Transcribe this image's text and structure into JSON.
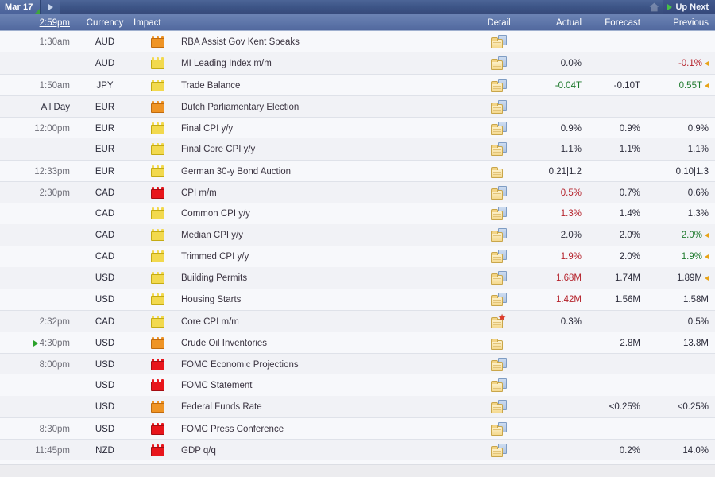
{
  "topbar": {
    "date_label": "Mar 17",
    "next_day_icon": "chevron-right-icon",
    "home_icon": "home-icon",
    "up_next_label": "Up Next",
    "up_next_icon": "play-triangle-icon"
  },
  "columns": {
    "time": "2:59pm",
    "currency": "Currency",
    "impact": "Impact",
    "detail": "Detail",
    "actual": "Actual",
    "forecast": "Forecast",
    "previous": "Previous"
  },
  "colors": {
    "impact_low": "#f2d94e",
    "impact_medium": "#ef9425",
    "impact_high": "#e8151b",
    "value_better": "#1f7a2e",
    "value_worse": "#b5232c",
    "value_neutral": "#2b2b3a",
    "revision_arrow": "#e8a317",
    "next_marker": "#2aa22a",
    "header_blue": "#5d75a9"
  },
  "rows": [
    {
      "time": "1:30am",
      "currency": "AUD",
      "impact": "medium",
      "event": "RBA Assist Gov Kent Speaks",
      "detail_icon": "folder-page-icon",
      "actual": "",
      "actual_tone": "neutral",
      "forecast": "",
      "previous": "",
      "previous_tone": "neutral",
      "revised": false,
      "next": false
    },
    {
      "time": "",
      "currency": "AUD",
      "impact": "low",
      "event": "MI Leading Index m/m",
      "detail_icon": "folder-page-icon",
      "actual": "0.0%",
      "actual_tone": "neutral",
      "forecast": "",
      "previous": "-0.1%",
      "previous_tone": "worse",
      "revised": true,
      "next": false
    },
    {
      "time": "1:50am",
      "currency": "JPY",
      "impact": "low",
      "event": "Trade Balance",
      "detail_icon": "folder-page-icon",
      "actual": "-0.04T",
      "actual_tone": "better",
      "forecast": "-0.10T",
      "previous": "0.55T",
      "previous_tone": "better",
      "revised": true,
      "next": false
    },
    {
      "time": "All Day",
      "currency": "EUR",
      "impact": "medium",
      "event": "Dutch Parliamentary Election",
      "detail_icon": "folder-page-icon",
      "actual": "",
      "actual_tone": "neutral",
      "forecast": "",
      "previous": "",
      "previous_tone": "neutral",
      "revised": false,
      "next": false
    },
    {
      "time": "12:00pm",
      "currency": "EUR",
      "impact": "low",
      "event": "Final CPI y/y",
      "detail_icon": "folder-page-icon",
      "actual": "0.9%",
      "actual_tone": "neutral",
      "forecast": "0.9%",
      "previous": "0.9%",
      "previous_tone": "neutral",
      "revised": false,
      "next": false
    },
    {
      "time": "",
      "currency": "EUR",
      "impact": "low",
      "event": "Final Core CPI y/y",
      "detail_icon": "folder-page-icon",
      "actual": "1.1%",
      "actual_tone": "neutral",
      "forecast": "1.1%",
      "previous": "1.1%",
      "previous_tone": "neutral",
      "revised": false,
      "next": false
    },
    {
      "time": "12:33pm",
      "currency": "EUR",
      "impact": "low",
      "event": "German 30-y Bond Auction",
      "detail_icon": "folder-icon",
      "actual": "0.21|1.2",
      "actual_tone": "neutral",
      "forecast": "",
      "previous": "0.10|1.3",
      "previous_tone": "neutral",
      "revised": false,
      "next": false
    },
    {
      "time": "2:30pm",
      "currency": "CAD",
      "impact": "high",
      "event": "CPI m/m",
      "detail_icon": "folder-page-icon",
      "actual": "0.5%",
      "actual_tone": "worse",
      "forecast": "0.7%",
      "previous": "0.6%",
      "previous_tone": "neutral",
      "revised": false,
      "next": false
    },
    {
      "time": "",
      "currency": "CAD",
      "impact": "low",
      "event": "Common CPI y/y",
      "detail_icon": "folder-page-icon",
      "actual": "1.3%",
      "actual_tone": "worse",
      "forecast": "1.4%",
      "previous": "1.3%",
      "previous_tone": "neutral",
      "revised": false,
      "next": false
    },
    {
      "time": "",
      "currency": "CAD",
      "impact": "low",
      "event": "Median CPI y/y",
      "detail_icon": "folder-page-icon",
      "actual": "2.0%",
      "actual_tone": "neutral",
      "forecast": "2.0%",
      "previous": "2.0%",
      "previous_tone": "better",
      "revised": true,
      "next": false
    },
    {
      "time": "",
      "currency": "CAD",
      "impact": "low",
      "event": "Trimmed CPI y/y",
      "detail_icon": "folder-page-icon",
      "actual": "1.9%",
      "actual_tone": "worse",
      "forecast": "2.0%",
      "previous": "1.9%",
      "previous_tone": "better",
      "revised": true,
      "next": false
    },
    {
      "time": "",
      "currency": "USD",
      "impact": "low",
      "event": "Building Permits",
      "detail_icon": "folder-page-icon",
      "actual": "1.68M",
      "actual_tone": "worse",
      "forecast": "1.74M",
      "previous": "1.89M",
      "previous_tone": "neutral",
      "revised": true,
      "next": false
    },
    {
      "time": "",
      "currency": "USD",
      "impact": "low",
      "event": "Housing Starts",
      "detail_icon": "folder-page-icon",
      "actual": "1.42M",
      "actual_tone": "worse",
      "forecast": "1.56M",
      "previous": "1.58M",
      "previous_tone": "neutral",
      "revised": false,
      "next": false
    },
    {
      "time": "2:32pm",
      "currency": "CAD",
      "impact": "low",
      "event": "Core CPI m/m",
      "detail_icon": "folder-star-icon",
      "actual": "0.3%",
      "actual_tone": "neutral",
      "forecast": "",
      "previous": "0.5%",
      "previous_tone": "neutral",
      "revised": false,
      "next": false
    },
    {
      "time": "4:30pm",
      "currency": "USD",
      "impact": "medium",
      "event": "Crude Oil Inventories",
      "detail_icon": "folder-icon",
      "actual": "",
      "actual_tone": "neutral",
      "forecast": "2.8M",
      "previous": "13.8M",
      "previous_tone": "neutral",
      "revised": false,
      "next": true
    },
    {
      "time": "8:00pm",
      "currency": "USD",
      "impact": "high",
      "event": "FOMC Economic Projections",
      "detail_icon": "folder-page-icon",
      "actual": "",
      "actual_tone": "neutral",
      "forecast": "",
      "previous": "",
      "previous_tone": "neutral",
      "revised": false,
      "next": false
    },
    {
      "time": "",
      "currency": "USD",
      "impact": "high",
      "event": "FOMC Statement",
      "detail_icon": "folder-page-icon",
      "actual": "",
      "actual_tone": "neutral",
      "forecast": "",
      "previous": "",
      "previous_tone": "neutral",
      "revised": false,
      "next": false
    },
    {
      "time": "",
      "currency": "USD",
      "impact": "medium",
      "event": "Federal Funds Rate",
      "detail_icon": "folder-page-icon",
      "actual": "",
      "actual_tone": "neutral",
      "forecast": "<0.25%",
      "previous": "<0.25%",
      "previous_tone": "neutral",
      "revised": false,
      "next": false
    },
    {
      "time": "8:30pm",
      "currency": "USD",
      "impact": "high",
      "event": "FOMC Press Conference",
      "detail_icon": "folder-page-icon",
      "actual": "",
      "actual_tone": "neutral",
      "forecast": "",
      "previous": "",
      "previous_tone": "neutral",
      "revised": false,
      "next": false
    },
    {
      "time": "11:45pm",
      "currency": "NZD",
      "impact": "high",
      "event": "GDP q/q",
      "detail_icon": "folder-page-icon",
      "actual": "",
      "actual_tone": "neutral",
      "forecast": "0.2%",
      "previous": "14.0%",
      "previous_tone": "neutral",
      "revised": false,
      "next": false
    }
  ]
}
